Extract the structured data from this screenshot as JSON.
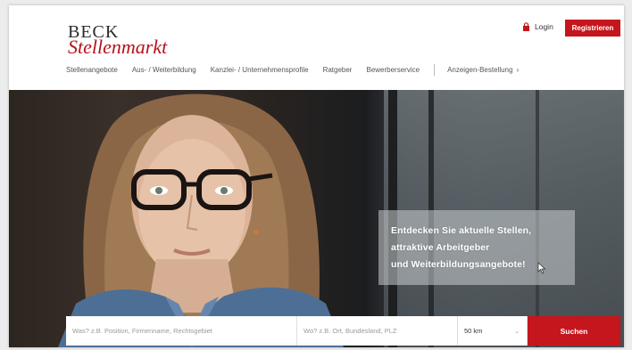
{
  "brand": {
    "line1": "BECK",
    "line2": "Stellenmarkt",
    "accent_color": "#c4161c"
  },
  "header": {
    "login_label": "Login",
    "register_label": "Registrieren"
  },
  "nav": {
    "items": [
      "Stellenangebote",
      "Aus- / Weiterbildung",
      "Kanzlei- / Unternehmensprofile",
      "Ratgeber",
      "Bewerberservice"
    ],
    "order_label": "Anzeigen-Bestellung",
    "order_arrow": "›"
  },
  "hero": {
    "tagline": [
      "Entdecken Sie aktuelle Stellen,",
      "attraktive Arbeitgeber",
      "und Weiterbildungsangebote!"
    ]
  },
  "search": {
    "what_placeholder": "Was? z.B. Position, Firmenname, Rechtsgebiet",
    "where_placeholder": "Wo? z.B. Ort, Bundesland, PLZ",
    "radius_value": "50 km",
    "radius_chevron": "⌄",
    "button_label": "Suchen"
  },
  "icons": {
    "login": "lock-icon",
    "cursor": "mouse-pointer-icon"
  }
}
